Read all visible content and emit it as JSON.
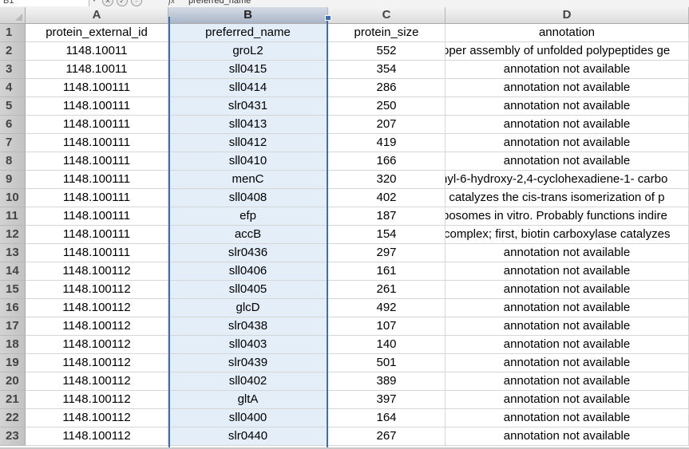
{
  "formula_bar": {
    "name_box": "B1",
    "fx_label": "fx",
    "content": "preferred_name"
  },
  "columns": [
    "A",
    "B",
    "C",
    "D"
  ],
  "row_numbers": [
    "1",
    "2",
    "3",
    "4",
    "5",
    "6",
    "7",
    "8",
    "9",
    "10",
    "11",
    "12",
    "13",
    "14",
    "15",
    "16",
    "17",
    "18",
    "19",
    "20",
    "21",
    "22",
    "23"
  ],
  "selected_column": "B",
  "rows": [
    [
      "protein_external_id",
      "preferred_name",
      "protein_size",
      "annotation"
    ],
    [
      "1148.10011",
      "groL2",
      "552",
      "oper assembly of unfolded polypeptides ge"
    ],
    [
      "1148.10011",
      "sll0415",
      "354",
      "annotation not available"
    ],
    [
      "1148.100111",
      "sll0414",
      "286",
      "annotation not available"
    ],
    [
      "1148.100111",
      "slr0431",
      "250",
      "annotation not available"
    ],
    [
      "1148.100111",
      "sll0413",
      "207",
      "annotation not available"
    ],
    [
      "1148.100111",
      "sll0412",
      "419",
      "annotation not available"
    ],
    [
      "1148.100111",
      "sll0410",
      "166",
      "annotation not available"
    ],
    [
      "1148.100111",
      "menC",
      "320",
      "nyl-6-hydroxy-2,4-cyclohexadiene-1- carbo"
    ],
    [
      "1148.100111",
      "sll0408",
      "402",
      "t catalyzes the cis-trans isomerization of p"
    ],
    [
      "1148.100111",
      "efp",
      "187",
      "bosomes in vitro. Probably functions indire"
    ],
    [
      "1148.100111",
      "accB",
      "154",
      "complex; first, biotin carboxylase catalyzes"
    ],
    [
      "1148.100111",
      "slr0436",
      "297",
      "annotation not available"
    ],
    [
      "1148.100112",
      "sll0406",
      "161",
      "annotation not available"
    ],
    [
      "1148.100112",
      "sll0405",
      "261",
      "annotation not available"
    ],
    [
      "1148.100112",
      "glcD",
      "492",
      "annotation not available"
    ],
    [
      "1148.100112",
      "slr0438",
      "107",
      "annotation not available"
    ],
    [
      "1148.100112",
      "sll0403",
      "140",
      "annotation not available"
    ],
    [
      "1148.100112",
      "slr0439",
      "501",
      "annotation not available"
    ],
    [
      "1148.100112",
      "sll0402",
      "389",
      "annotation not available"
    ],
    [
      "1148.100112",
      "gltA",
      "397",
      "annotation not available"
    ],
    [
      "1148.100112",
      "sll0400",
      "164",
      "annotation not available"
    ],
    [
      "1148.100112",
      "slr0440",
      "267",
      "annotation not available"
    ]
  ],
  "clipped_annotation_rows": [
    1,
    8,
    9,
    10,
    11
  ],
  "colors": {
    "selection_border": "#3f6db2",
    "selected_column_fill": "#e3eef9",
    "header_bg": "#d4d4d4"
  }
}
